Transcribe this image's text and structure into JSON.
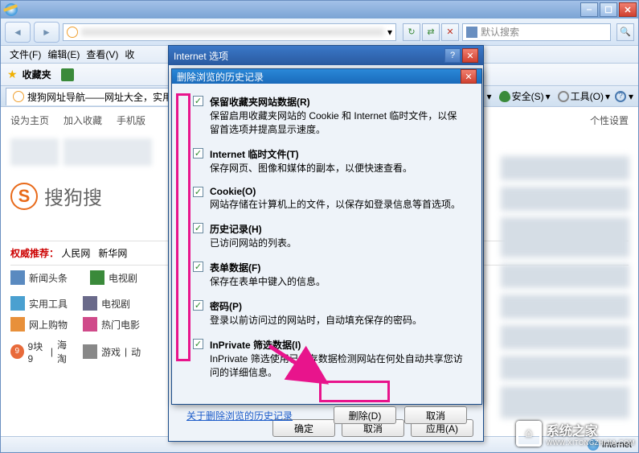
{
  "window": {
    "min": "‒",
    "max": "☐",
    "close": "✕"
  },
  "nav": {
    "back": "◄",
    "fwd": "►",
    "refresh": "↻",
    "stop": "✕"
  },
  "searchbox": {
    "placeholder": "默认搜索"
  },
  "menubar": {
    "file": "文件(F)",
    "edit": "编辑(E)",
    "view": "查看(V)",
    "fav": "收"
  },
  "favbar": {
    "label": "收藏夹"
  },
  "tab": {
    "title": "搜狗网址导航——网址大全，实用"
  },
  "toolbar": {
    "safety": "安全(S)",
    "tools": "工具(O)"
  },
  "page": {
    "nav1": "设为主页",
    "nav2": "加入收藏",
    "nav3": "手机版",
    "nav4": "个性设置",
    "sogou": "搜狗搜",
    "recLabel": "权威推荐：",
    "rec1": "人民网",
    "rec2": "新华网",
    "c1": "新闻头条",
    "c2": "电视剧",
    "c3": "实用工具",
    "c4": "电视剧",
    "c5": "网上购物",
    "c6": "热门电影",
    "c7": "9块9",
    "c8": "海淘",
    "c9": "游戏",
    "c10": "动"
  },
  "options_dialog": {
    "title": "Internet 选项",
    "ok": "确定",
    "cancel": "取消",
    "apply": "应用(A)"
  },
  "delete_dialog": {
    "title": "删除浏览的历史记录",
    "close": "✕",
    "items": [
      {
        "checked": true,
        "label": "保留收藏夹网站数据(R)",
        "desc": "保留启用收藏夹网站的 Cookie 和 Internet 临时文件，以保留首选项并提高显示速度。"
      },
      {
        "checked": true,
        "label": "Internet 临时文件(T)",
        "desc": "保存网页、图像和媒体的副本，以便快速查看。"
      },
      {
        "checked": true,
        "label": "Cookie(O)",
        "desc": "网站存储在计算机上的文件，以保存如登录信息等首选项。"
      },
      {
        "checked": true,
        "label": "历史记录(H)",
        "desc": "已访问网站的列表。"
      },
      {
        "checked": true,
        "label": "表单数据(F)",
        "desc": "保存在表单中键入的信息。"
      },
      {
        "checked": true,
        "label": "密码(P)",
        "desc": "登录以前访问过的网站时，自动填充保存的密码。"
      },
      {
        "checked": true,
        "label": "InPrivate 筛选数据(I)",
        "desc": "InPrivate 筛选使用已保存数据检测网站在何处自动共享您访问的详细信息。"
      }
    ],
    "about_link": "关于删除浏览的历史记录",
    "delete_btn": "删除(D)",
    "cancel_btn": "取消"
  },
  "status": {
    "zone": "Internet"
  },
  "watermark": {
    "text": "系统之家",
    "url": "WWW.XITONGZHIJIA.COM"
  }
}
